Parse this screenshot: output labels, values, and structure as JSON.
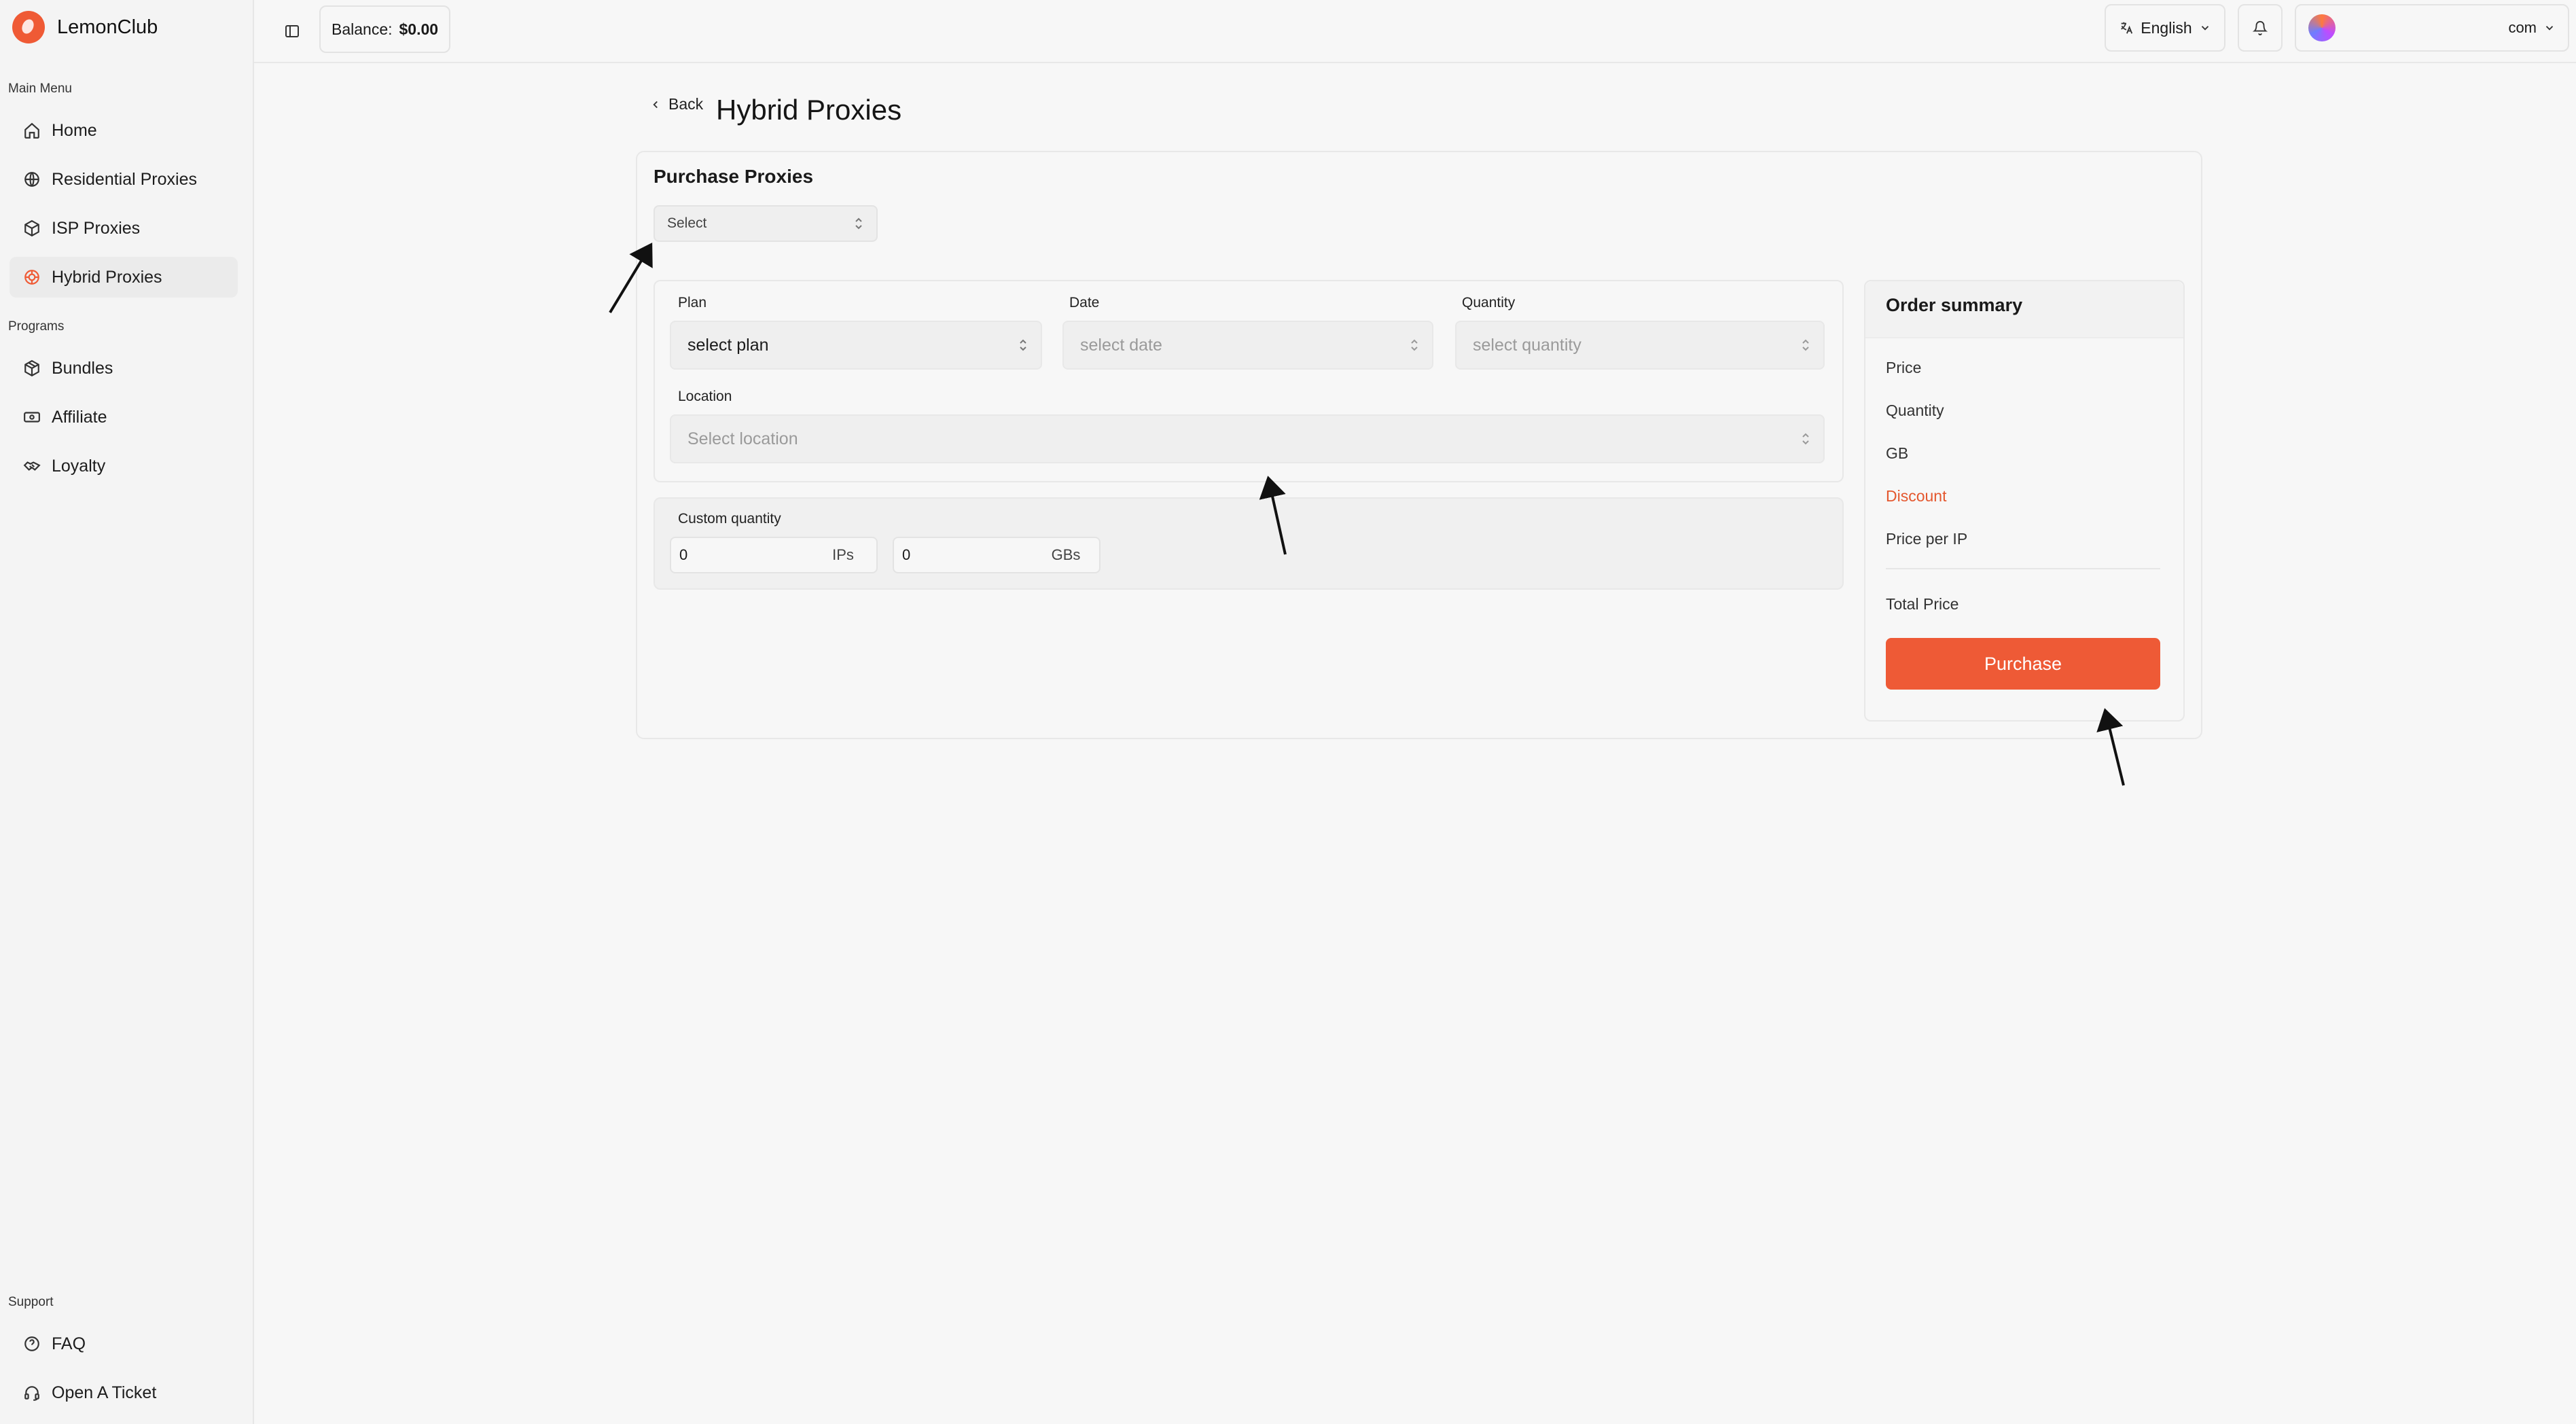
{
  "app": {
    "name": "LemonClub",
    "brand_color": "#ef5a35"
  },
  "sidebar": {
    "main_menu_label": "Main Menu",
    "main_items": [
      {
        "label": "Home",
        "icon": "home-icon"
      },
      {
        "label": "Residential Proxies",
        "icon": "globe-icon"
      },
      {
        "label": "ISP Proxies",
        "icon": "box-icon"
      },
      {
        "label": "Hybrid Proxies",
        "icon": "hybrid-icon",
        "active": true
      }
    ],
    "programs_label": "Programs",
    "program_items": [
      {
        "label": "Bundles",
        "icon": "package-icon"
      },
      {
        "label": "Affiliate",
        "icon": "banknote-icon"
      },
      {
        "label": "Loyalty",
        "icon": "handshake-icon"
      }
    ],
    "support_label": "Support",
    "support_items": [
      {
        "label": "FAQ",
        "icon": "help-circle-icon"
      },
      {
        "label": "Open A Ticket",
        "icon": "headset-icon"
      }
    ]
  },
  "topbar": {
    "balance_label": "Balance:",
    "balance_value": "$0.00",
    "language": "English",
    "user_email_suffix": "com"
  },
  "page": {
    "back_label": "Back",
    "title": "Hybrid Proxies",
    "card_title": "Purchase Proxies",
    "top_select_placeholder": "Select",
    "plan_label": "Plan",
    "plan_value": "select plan",
    "date_label": "Date",
    "date_placeholder": "select date",
    "quantity_label": "Quantity",
    "quantity_placeholder": "select quantity",
    "location_label": "Location",
    "location_placeholder": "Select location",
    "custom_quantity_label": "Custom quantity",
    "ips_value": "0",
    "ips_unit": "IPs",
    "gbs_value": "0",
    "gbs_unit": "GBs"
  },
  "summary": {
    "title": "Order summary",
    "price_label": "Price",
    "quantity_label": "Quantity",
    "gb_label": "GB",
    "discount_label": "Discount",
    "price_per_ip_label": "Price per IP",
    "total_label": "Total Price",
    "purchase_label": "Purchase",
    "accent_color": "#ee5a36"
  }
}
